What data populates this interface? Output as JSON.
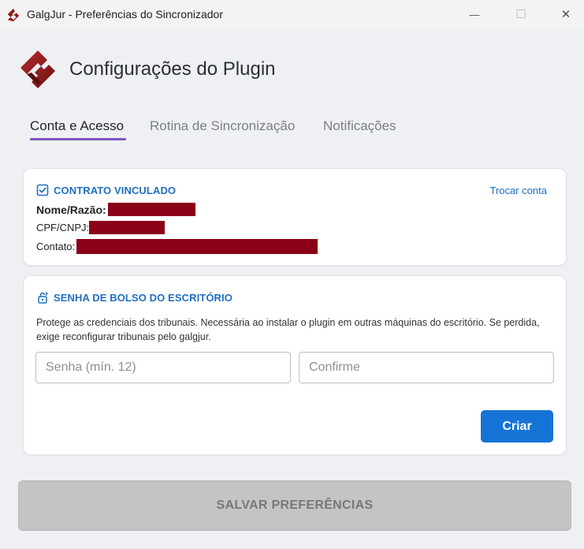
{
  "window": {
    "title": "GalgJur - Preferências do Sincronizador",
    "minimize_glyph": "—",
    "maximize_glyph": "☐",
    "close_glyph": "✕"
  },
  "header": {
    "title": "Configurações do Plugin",
    "logo_icon": "galgjur-logo-icon",
    "brand_color": "#8b1a1a"
  },
  "tabs": [
    {
      "label": "Conta e Acesso",
      "active": true
    },
    {
      "label": "Rotina de Sincronização",
      "active": false
    },
    {
      "label": "Notificações",
      "active": false
    }
  ],
  "contract": {
    "heading": "CONTRATO VINCULADO",
    "heading_icon": "checkbox-checked-icon",
    "swap_link": "Trocar conta",
    "fields": [
      {
        "label": "Nome/Razão:",
        "value_redacted": true
      },
      {
        "label": "CPF/CNPJ:",
        "value_redacted": true
      },
      {
        "label": "Contato:",
        "value_redacted": true
      }
    ]
  },
  "pocket_password": {
    "heading": "SENHA DE BOLSO DO ESCRITÓRIO",
    "heading_icon": "lock-reset-icon",
    "description": "Protege as credenciais dos tribunais. Necessária ao instalar o plugin em outras máquinas do escritório. Se perdida, exige reconfigurar tribunais pelo galgjur.",
    "password_placeholder": "Senha (mín. 12)",
    "confirm_placeholder": "Confirme",
    "create_label": "Criar"
  },
  "footer": {
    "save_label": "SALVAR PREFERÊNCIAS",
    "save_enabled": false
  },
  "colors": {
    "accent_blue": "#1673d6",
    "tab_underline": "#7e57c2",
    "redaction": "#8b0019"
  }
}
